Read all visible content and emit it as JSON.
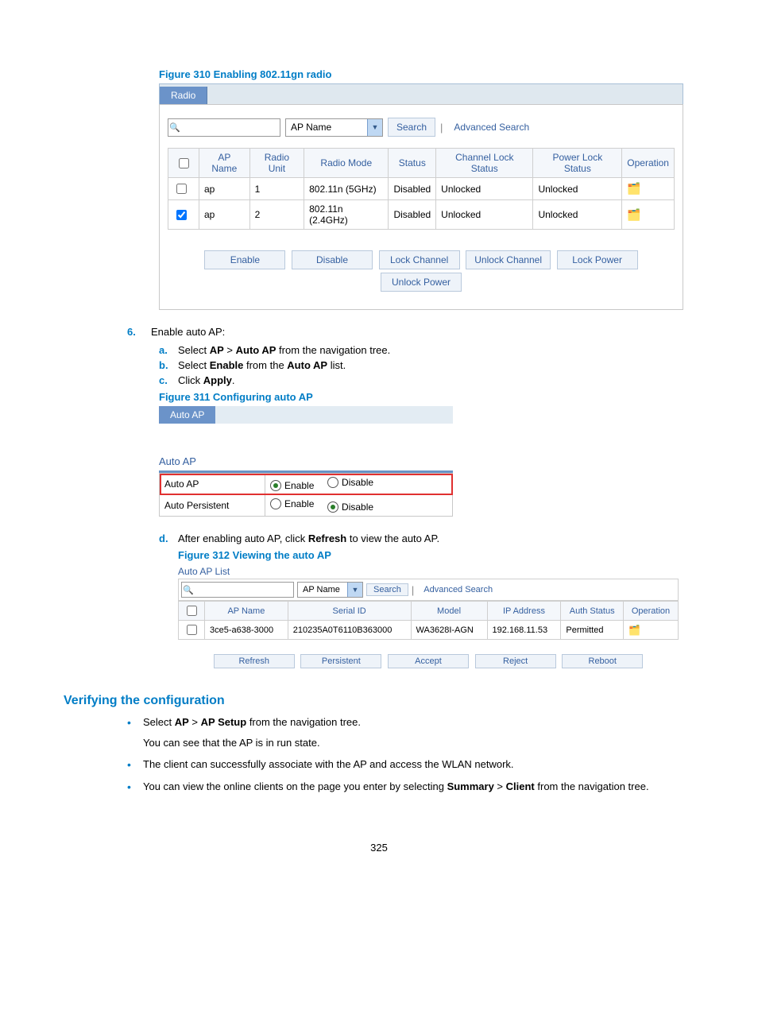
{
  "figure310": {
    "caption": "Figure 310 Enabling 802.11gn radio",
    "tab": "Radio",
    "selectLabel": "AP Name",
    "searchBtn": "Search",
    "advancedSearch": "Advanced Search",
    "headers": {
      "apName": "AP Name",
      "radioUnit": "Radio Unit",
      "radioMode": "Radio Mode",
      "status": "Status",
      "channelLock": "Channel Lock Status",
      "powerLock": "Power Lock Status",
      "operation": "Operation"
    },
    "rows": [
      {
        "checked": false,
        "apName": "ap",
        "radioUnit": "1",
        "radioMode": "802.11n (5GHz)",
        "status": "Disabled",
        "channelLock": "Unlocked",
        "powerLock": "Unlocked"
      },
      {
        "checked": true,
        "apName": "ap",
        "radioUnit": "2",
        "radioMode": "802.11n (2.4GHz)",
        "status": "Disabled",
        "channelLock": "Unlocked",
        "powerLock": "Unlocked"
      }
    ],
    "buttons": {
      "enable": "Enable",
      "disable": "Disable",
      "lockChannel": "Lock Channel",
      "unlockChannel": "Unlock Channel",
      "lockPower": "Lock Power",
      "unlockPower": "Unlock Power"
    }
  },
  "step6": {
    "number": "6.",
    "title": "Enable auto AP:",
    "a": {
      "label": "a.",
      "pre": "Select ",
      "b1": "AP",
      "mid": " > ",
      "b2": "Auto AP",
      "post": " from the navigation tree."
    },
    "b": {
      "label": "b.",
      "pre": "Select ",
      "b1": "Enable",
      "mid": " from the ",
      "b2": "Auto AP",
      "post": " list."
    },
    "c": {
      "label": "c.",
      "pre": "Click ",
      "b1": "Apply",
      "post": "."
    },
    "d": {
      "label": "d.",
      "pre": "After enabling auto AP, click ",
      "b1": "Refresh",
      "post": " to view the auto AP."
    }
  },
  "figure311": {
    "caption": "Figure 311 Configuring auto AP",
    "tab": "Auto AP",
    "sectionTitle": "Auto AP",
    "rows": {
      "autoAP": {
        "label": "Auto AP",
        "enable": "Enable",
        "disable": "Disable",
        "selected": "enable"
      },
      "autoPersistent": {
        "label": "Auto Persistent",
        "enable": "Enable",
        "disable": "Disable",
        "selected": "disable"
      }
    }
  },
  "figure312": {
    "caption": "Figure 312 Viewing the auto AP",
    "listTitle": "Auto AP List",
    "selectLabel": "AP Name",
    "searchBtn": "Search",
    "advancedSearch": "Advanced Search",
    "headers": {
      "apName": "AP Name",
      "serialId": "Serial ID",
      "model": "Model",
      "ipAddress": "IP Address",
      "authStatus": "Auth Status",
      "operation": "Operation"
    },
    "row": {
      "apName": "3ce5-a638-3000",
      "serialId": "210235A0T6110B363000",
      "model": "WA3628I-AGN",
      "ipAddress": "192.168.11.53",
      "authStatus": "Permitted"
    },
    "buttons": {
      "refresh": "Refresh",
      "persistent": "Persistent",
      "accept": "Accept",
      "reject": "Reject",
      "reboot": "Reboot"
    }
  },
  "verify": {
    "heading": "Verifying the configuration",
    "bullet1a": "Select ",
    "bullet1b1": "AP",
    "bullet1mid": " > ",
    "bullet1b2": "AP Setup",
    "bullet1c": " from the navigation tree.",
    "bullet1line2": "You can see that the AP is in run state.",
    "bullet2": "The client can successfully associate with the AP and access the WLAN network.",
    "bullet3a": "You can view the online clients on the page you enter by selecting ",
    "bullet3b1": "Summary",
    "bullet3mid": " > ",
    "bullet3b2": "Client",
    "bullet3c": " from the navigation tree."
  },
  "pageNumber": "325"
}
